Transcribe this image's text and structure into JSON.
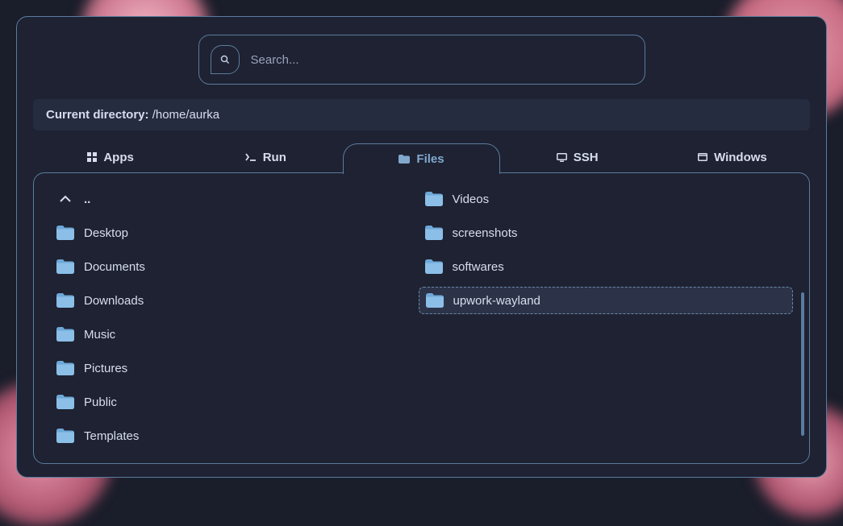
{
  "search": {
    "placeholder": "Search..."
  },
  "directory": {
    "label": "Current directory: ",
    "path": "/home/aurka"
  },
  "tabs": [
    {
      "id": "apps",
      "label": "Apps",
      "icon": "apps-icon",
      "active": false
    },
    {
      "id": "run",
      "label": "Run",
      "icon": "terminal-icon",
      "active": false
    },
    {
      "id": "files",
      "label": "Files",
      "icon": "folder-small-icon",
      "active": true
    },
    {
      "id": "ssh",
      "label": "SSH",
      "icon": "monitor-icon",
      "active": false
    },
    {
      "id": "windows",
      "label": "Windows",
      "icon": "window-icon",
      "active": false
    }
  ],
  "files": {
    "parent_label": "..",
    "left": [
      {
        "name": "Desktop",
        "type": "folder"
      },
      {
        "name": "Documents",
        "type": "folder"
      },
      {
        "name": "Downloads",
        "type": "folder"
      },
      {
        "name": "Music",
        "type": "folder"
      },
      {
        "name": "Pictures",
        "type": "folder"
      },
      {
        "name": "Public",
        "type": "folder"
      },
      {
        "name": "Templates",
        "type": "folder"
      }
    ],
    "right": [
      {
        "name": "Videos",
        "type": "folder"
      },
      {
        "name": "screenshots",
        "type": "folder"
      },
      {
        "name": "softwares",
        "type": "folder"
      },
      {
        "name": "upwork-wayland",
        "type": "folder",
        "highlighted": true
      }
    ]
  },
  "colors": {
    "accent": "#5a7c9e",
    "folder": "#8bbfe8",
    "text": "#d8ddee",
    "active_text": "#82a8ce",
    "panel_bg": "#1e2232",
    "bar_bg": "#262c40"
  }
}
